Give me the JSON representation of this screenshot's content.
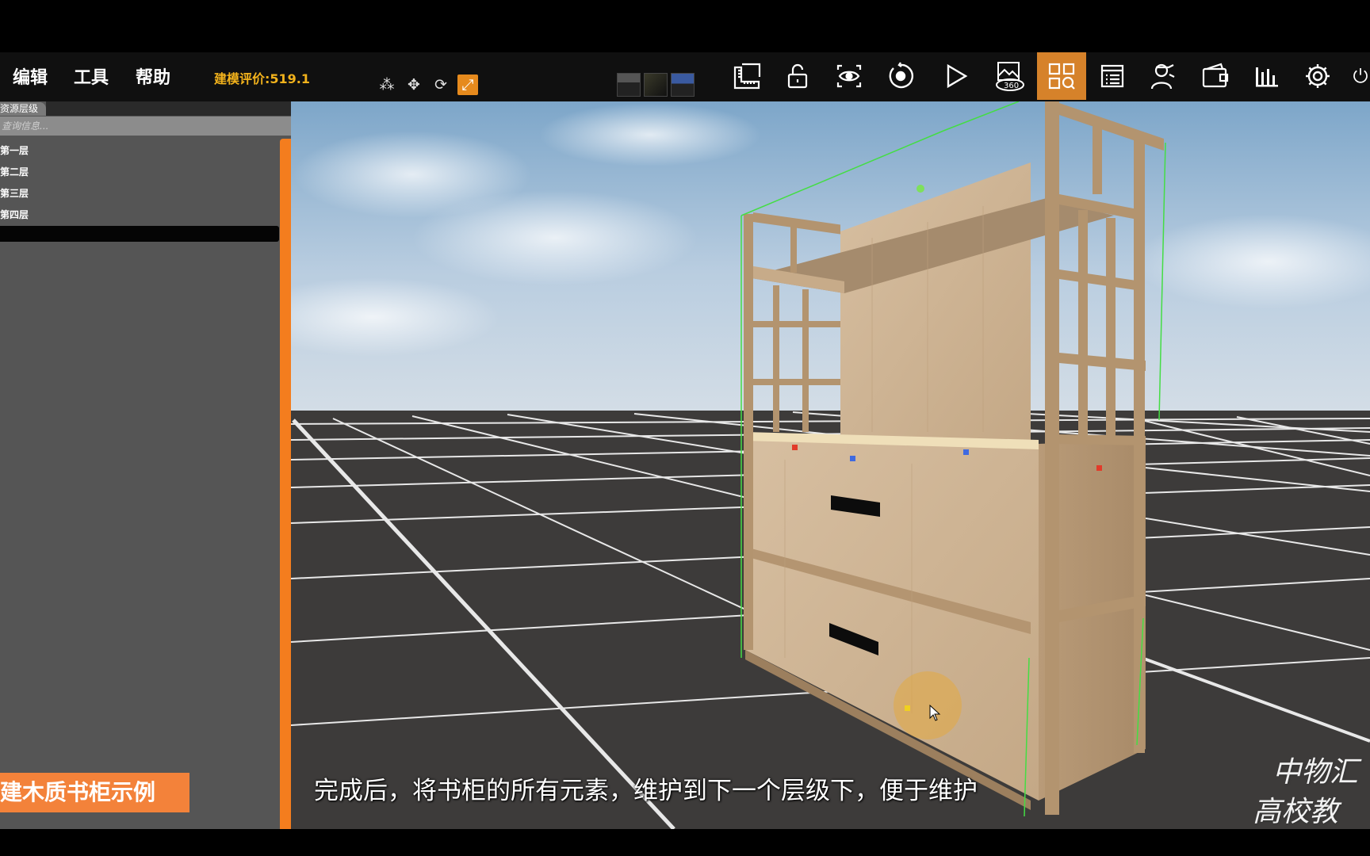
{
  "menu": {
    "edit": "编辑",
    "tools": "工具",
    "help": "帮助"
  },
  "rating": "建模评价:519.1",
  "toolbar_small": [
    {
      "icon": "scatter-icon",
      "glyph": "⁂"
    },
    {
      "icon": "move-icon",
      "glyph": "✥"
    },
    {
      "icon": "rotate-icon",
      "glyph": "⟳"
    },
    {
      "icon": "scale-icon",
      "glyph": "⤢",
      "active": true
    }
  ],
  "toolbar_main": [
    "ruler-icon",
    "unlock-icon",
    "eye-icon",
    "rotate-view-icon",
    "play-icon",
    "panorama-360-icon",
    "grid-search-icon",
    "list-icon",
    "person-icon",
    "wallet-icon",
    "bar-chart-icon",
    "gear-icon",
    "power-icon"
  ],
  "panorama_label": "360",
  "sidebar": {
    "tab": "资源层级",
    "search_placeholder": "查询信息...",
    "layers": [
      "第一层",
      "第二层",
      "第三层",
      "第四层"
    ]
  },
  "caption_badge": "建木质书柜示例",
  "subtitle": "完成后，将书柜的所有元素，维护到下一个层级下，便于维护",
  "watermark": {
    "line1": "中物汇",
    "line2": "高校教"
  },
  "colors": {
    "accent": "#f47d1e",
    "rating": "#f2b21c",
    "selection": "#44dd44"
  }
}
